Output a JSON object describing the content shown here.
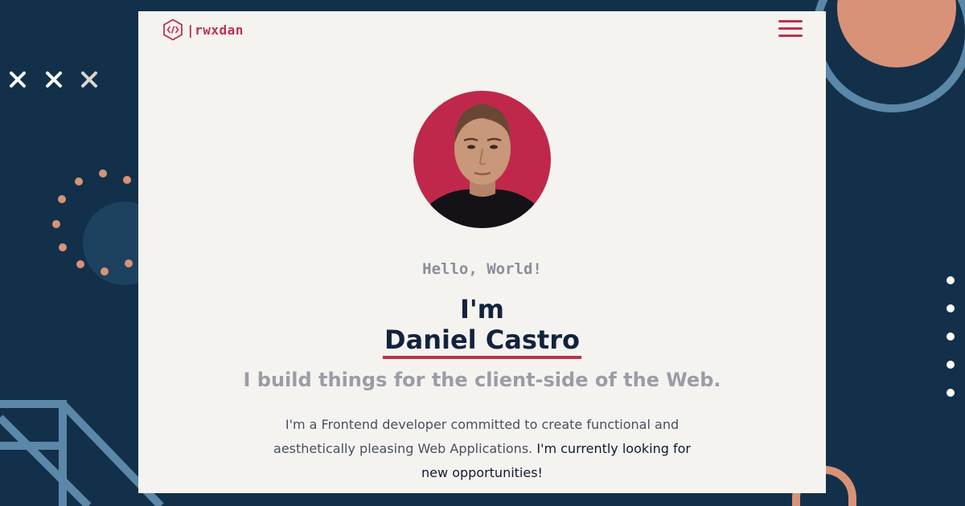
{
  "header": {
    "logo_text": "|rwxdan",
    "logo_icon": "code-hexagon-icon",
    "menu_icon": "hamburger-menu-icon"
  },
  "hero": {
    "avatar_alt": "Daniel Castro",
    "greeting": "Hello, World!",
    "im": "I'm",
    "name": "Daniel Castro",
    "tagline": "I build things for the client-side of the Web.",
    "intro_plain": "I'm a Frontend developer committed to create functional and aesthetically pleasing Web Applications.",
    "intro_strong": "I'm currently looking for new opportunities!"
  },
  "colors": {
    "background": "#13304a",
    "card": "#f5f3f0",
    "accent": "#c0304e",
    "heading": "#13233d",
    "muted": "#9b9ca6",
    "decor_peach": "#d89277",
    "decor_steel": "#5b87a8"
  }
}
